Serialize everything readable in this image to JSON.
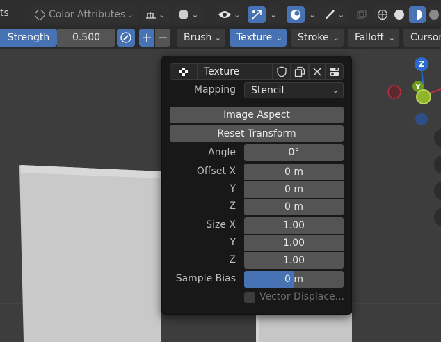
{
  "top_bar": {
    "left_text": "ts",
    "color_attributes_label": "Color Attributes"
  },
  "tool_bar": {
    "strength_label": "Strength",
    "strength_value": "0.500",
    "plus_label": "+",
    "minus_label": "−",
    "brush_label": "Brush",
    "texture_label": "Texture",
    "stroke_label": "Stroke",
    "falloff_label": "Falloff",
    "cursor_label": "Cursor"
  },
  "texture_panel": {
    "texture_name": "Texture",
    "mapping_label": "Mapping",
    "mapping_value": "Stencil",
    "image_aspect_label": "Image Aspect",
    "reset_transform_label": "Reset Transform",
    "angle_label": "Angle",
    "angle_value": "0°",
    "offset_x_label": "Offset X",
    "offset_x_value": "0 m",
    "offset_y_label": "Y",
    "offset_y_value": "0 m",
    "offset_z_label": "Z",
    "offset_z_value": "0 m",
    "size_x_label": "Size X",
    "size_x_value": "1.00",
    "size_y_label": "Y",
    "size_y_value": "1.00",
    "size_z_label": "Z",
    "size_z_value": "1.00",
    "sample_bias_label": "Sample Bias",
    "sample_bias_value": "0 m",
    "vector_displacement_label": "Vector Displace..."
  },
  "gizmo": {
    "z_label": "Z",
    "y_label": "Y"
  },
  "colors": {
    "accent_blue": "#4772b3",
    "gizmo_x_red": "#c0313f",
    "gizmo_y_green": "#6d9a1c",
    "gizmo_z_blue": "#2a6bd0"
  }
}
